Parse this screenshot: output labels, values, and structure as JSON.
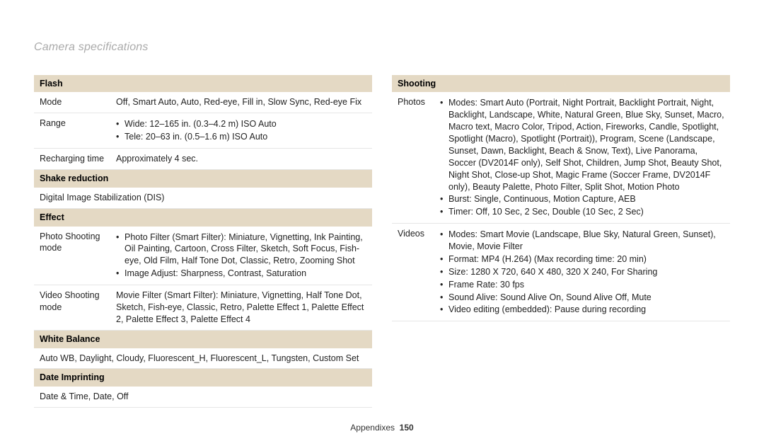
{
  "page_title": "Camera specifications",
  "footer_section": "Appendixes",
  "footer_page": "150",
  "left": {
    "flash": {
      "header": "Flash",
      "mode_label": "Mode",
      "mode_value": "Off, Smart Auto, Auto, Red-eye, Fill in, Slow Sync, Red-eye Fix",
      "range_label": "Range",
      "range_bullets": [
        "Wide: 12–165 in. (0.3–4.2 m) ISO Auto",
        "Tele: 20–63 in. (0.5–1.6 m) ISO Auto"
      ],
      "recharge_label": "Recharging time",
      "recharge_value": "Approximately 4 sec."
    },
    "shake": {
      "header": "Shake reduction",
      "value": "Digital Image Stabilization (DIS)"
    },
    "effect": {
      "header": "Effect",
      "photo_label": "Photo Shooting mode",
      "photo_bullets": [
        "Photo Filter (Smart Filter): Miniature, Vignetting, Ink Painting, Oil Painting, Cartoon, Cross Filter, Sketch, Soft Focus, Fish-eye, Old Film, Half Tone Dot, Classic, Retro, Zooming Shot",
        "Image Adjust: Sharpness, Contrast, Saturation"
      ],
      "video_label": "Video Shooting mode",
      "video_value": "Movie Filter (Smart Filter): Miniature, Vignetting, Half Tone Dot, Sketch, Fish-eye, Classic, Retro, Palette Effect 1, Palette Effect 2, Palette Effect 3, Palette Effect 4"
    },
    "wb": {
      "header": "White Balance",
      "value": "Auto WB, Daylight, Cloudy, Fluorescent_H, Fluorescent_L, Tungsten, Custom Set"
    },
    "date": {
      "header": "Date Imprinting",
      "value": "Date & Time, Date, Off"
    }
  },
  "right": {
    "shooting": {
      "header": "Shooting",
      "photos_label": "Photos",
      "photos_bullets": [
        "Modes: Smart Auto (Portrait, Night Portrait, Backlight Portrait, Night, Backlight, Landscape, White, Natural Green, Blue Sky, Sunset, Macro, Macro text, Macro Color, Tripod, Action, Fireworks, Candle, Spotlight, Spotlight (Macro), Spotlight (Portrait)), Program, Scene (Landscape, Sunset, Dawn, Backlight, Beach & Snow, Text), Live Panorama, Soccer (DV2014F only), Self Shot, Children, Jump Shot, Beauty Shot, Night Shot, Close-up Shot, Magic Frame (Soccer Frame, DV2014F only), Beauty Palette, Photo Filter, Split Shot, Motion Photo",
        "Burst: Single, Continuous, Motion Capture, AEB",
        "Timer: Off, 10 Sec, 2 Sec, Double (10 Sec, 2 Sec)"
      ],
      "videos_label": "Videos",
      "videos_bullets": [
        "Modes: Smart Movie (Landscape, Blue Sky, Natural Green, Sunset), Movie, Movie Filter",
        "Format: MP4 (H.264) (Max recording time: 20 min)",
        "Size: 1280 X 720, 640 X 480, 320 X 240, For Sharing",
        "Frame Rate: 30 fps",
        "Sound Alive: Sound Alive On, Sound Alive Off, Mute",
        "Video editing (embedded): Pause during recording"
      ]
    }
  }
}
